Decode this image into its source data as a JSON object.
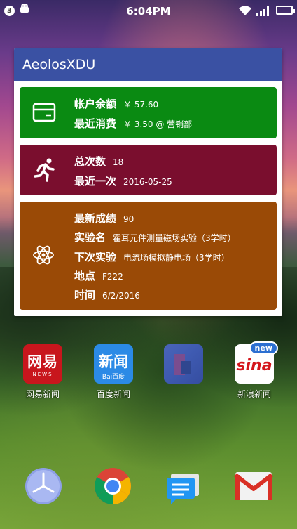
{
  "status_bar": {
    "notification_count": "3",
    "time": "6:04PM"
  },
  "widget": {
    "title": "AeolosXDU",
    "balance_card": {
      "balance_label": "帐户余额",
      "balance_value": "￥ 57.60",
      "recent_label": "最近消费",
      "recent_value": "￥ 3.50 @ 营销部"
    },
    "count_card": {
      "total_label": "总次数",
      "total_value": "18",
      "last_label": "最近一次",
      "last_value": "2016-05-25"
    },
    "grade_card": {
      "grade_label": "最新成绩",
      "grade_value": "90",
      "experiment_label": "实验名",
      "experiment_value": "霍耳元件测量磁场实验（3学时）",
      "next_label": "下次实验",
      "next_value": "电流场模拟静电场（3学时）",
      "location_label": "地点",
      "location_value": "F222",
      "time_label": "时间",
      "time_value": "6/2/2016"
    }
  },
  "apps": [
    {
      "label": "网易新闻",
      "icon": "netease-news-icon",
      "icon_text": "网易",
      "icon_sub": "NEWS"
    },
    {
      "label": "百度新闻",
      "icon": "baidu-news-icon",
      "icon_text": "新闻",
      "icon_sub": "Bai百度"
    },
    {
      "label": "",
      "icon": "folder-icon"
    },
    {
      "label": "新浪新闻",
      "icon": "sina-news-icon",
      "icon_text": "sina",
      "badge": "new"
    }
  ],
  "dock": [
    "clock-icon",
    "chrome-icon",
    "messaging-icon",
    "gmail-icon"
  ],
  "colors": {
    "header": "#3a51a3",
    "balance_card": "#0a8a12",
    "count_card": "#7a0e2e",
    "grade_card": "#9a4a06"
  }
}
